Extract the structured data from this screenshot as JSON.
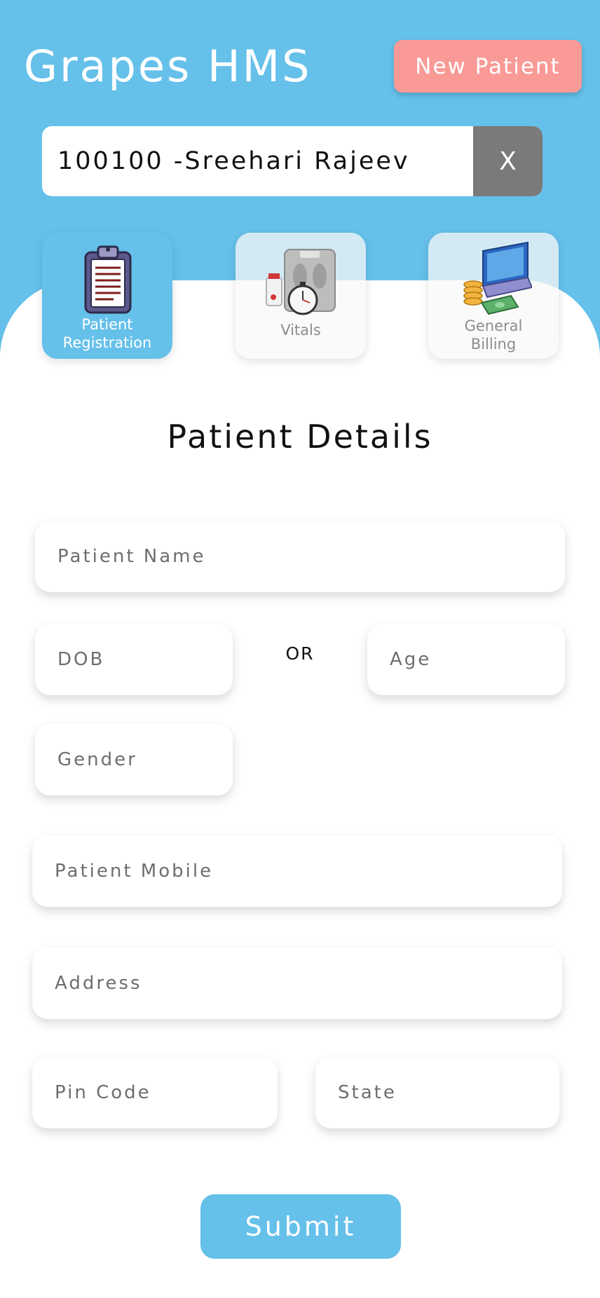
{
  "header": {
    "title": "Grapes HMS",
    "new_patient_label": "New Patient"
  },
  "search": {
    "value": "100100 -Sreehari Rajeev",
    "clear_label": "X"
  },
  "modules": [
    {
      "label_line1": "Patient",
      "label_line2": "Registration",
      "icon": "clipboard-icon",
      "active": true
    },
    {
      "label_line1": "Vitals",
      "label_line2": "",
      "icon": "weighing-scale-icon",
      "active": false
    },
    {
      "label_line1": "General",
      "label_line2": "Billing",
      "icon": "laptop-coins-icon",
      "active": false
    }
  ],
  "form": {
    "title": "Patient Details",
    "patient_name_placeholder": "Patient Name",
    "dob_placeholder": "DOB",
    "or_label": "OR",
    "age_placeholder": "Age",
    "gender_placeholder": "Gender",
    "mobile_placeholder": "Patient Mobile",
    "address_placeholder": "Address",
    "pincode_placeholder": "Pin Code",
    "state_placeholder": "State",
    "submit_label": "Submit"
  },
  "colors": {
    "primary": "#65c0ea",
    "accent": "#f99a97",
    "clear_button": "#7a7a7a"
  }
}
